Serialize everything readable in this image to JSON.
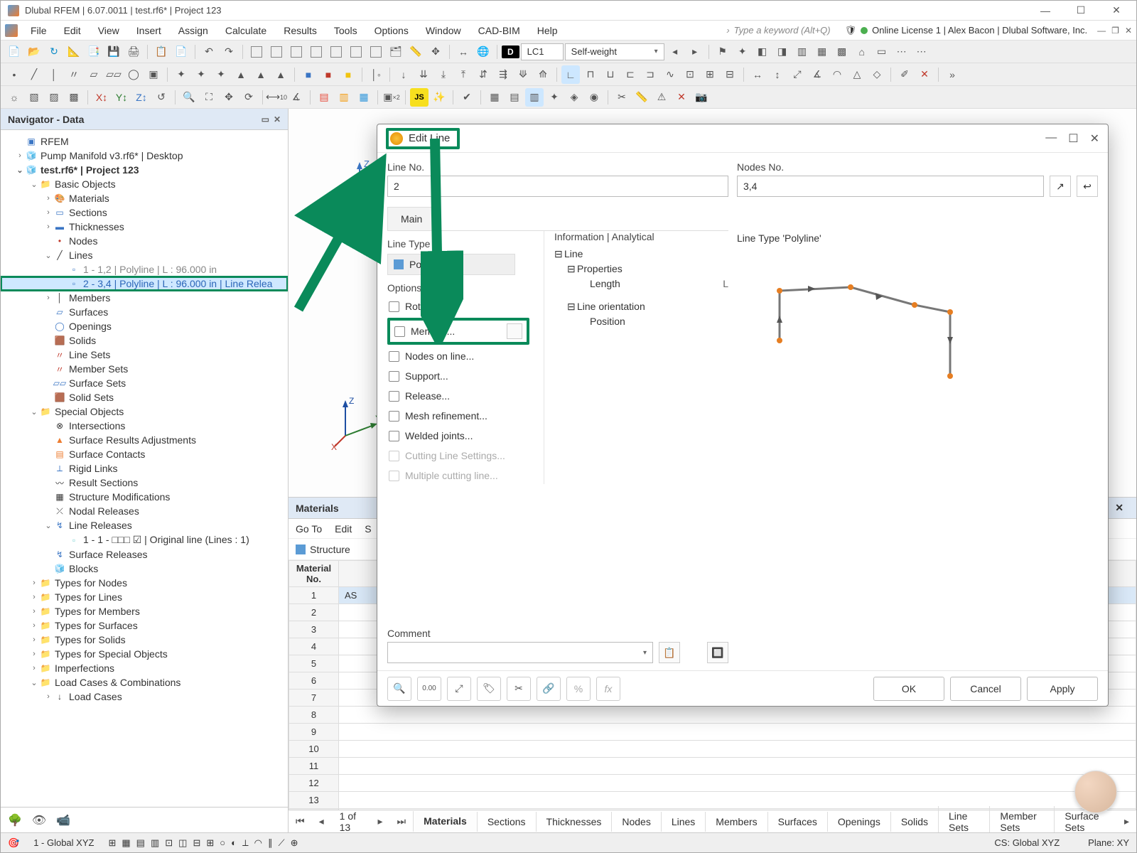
{
  "titlebar": {
    "title": "Dlubal RFEM | 6.07.0011 | test.rf6* | Project 123"
  },
  "menubar": {
    "items": [
      "File",
      "Edit",
      "View",
      "Insert",
      "Assign",
      "Calculate",
      "Results",
      "Tools",
      "Options",
      "Window",
      "CAD-BIM",
      "Help"
    ],
    "search_placeholder": "Type a keyword (Alt+Q)",
    "license": "Online License 1 | Alex Bacon | Dlubal Software, Inc."
  },
  "toolbar2": {
    "lc_badge": "D",
    "lc_code": "LC1",
    "lc_name": "Self-weight"
  },
  "navigator": {
    "title": "Navigator - Data",
    "root": "RFEM",
    "project1": "Pump Manifold v3.rf6* | Desktop",
    "project2": "test.rf6* | Project 123",
    "basic_objects": "Basic Objects",
    "materials": "Materials",
    "sections": "Sections",
    "thicknesses": "Thicknesses",
    "nodes": "Nodes",
    "lines": "Lines",
    "line1": "1 - 1,2 | Polyline | L : 96.000 in",
    "line2": "2 - 3,4 | Polyline | L : 96.000 in | Line Relea",
    "members": "Members",
    "surfaces": "Surfaces",
    "openings": "Openings",
    "solids": "Solids",
    "line_sets": "Line Sets",
    "member_sets": "Member Sets",
    "surface_sets": "Surface Sets",
    "solid_sets": "Solid Sets",
    "special_objects": "Special Objects",
    "intersections": "Intersections",
    "surface_results_adj": "Surface Results Adjustments",
    "surface_contacts": "Surface Contacts",
    "rigid_links": "Rigid Links",
    "result_sections": "Result Sections",
    "structure_mods": "Structure Modifications",
    "nodal_releases": "Nodal Releases",
    "line_releases": "Line Releases",
    "line_release_item": "1 - 1 - □□□ ☑ | Original line (Lines : 1)",
    "surface_releases": "Surface Releases",
    "blocks": "Blocks",
    "types_nodes": "Types for Nodes",
    "types_lines": "Types for Lines",
    "types_members": "Types for Members",
    "types_surfaces": "Types for Surfaces",
    "types_solids": "Types for Solids",
    "types_special": "Types for Special Objects",
    "imperfections": "Imperfections",
    "load_cases": "Load Cases & Combinations",
    "load_cases_sub": "Load Cases"
  },
  "materials_panel": {
    "title": "Materials",
    "menu": [
      "Go To",
      "Edit",
      "S"
    ],
    "sub": "Structure",
    "header": "Material\nNo.",
    "fill_label": "AS"
  },
  "pager": {
    "text": "1 of 13",
    "tabs": [
      "Materials",
      "Sections",
      "Thicknesses",
      "Nodes",
      "Lines",
      "Members",
      "Surfaces",
      "Openings",
      "Solids",
      "Line Sets",
      "Member Sets",
      "Surface Sets"
    ]
  },
  "statusbar": {
    "left": "1 - Global XYZ",
    "cs": "CS: Global XYZ",
    "plane": "Plane: XY"
  },
  "dialog": {
    "title": "Edit Line",
    "line_no_label": "Line No.",
    "line_no": "2",
    "nodes_no_label": "Nodes No.",
    "nodes_no": "3,4",
    "tab_main": "Main",
    "line_type_label": "Line Type",
    "line_type": "Polyline",
    "options_label": "Options",
    "opt_rotation": "Rotation...",
    "opt_member": "Member...",
    "opt_nodes_on_line": "Nodes on line...",
    "opt_support": "Support...",
    "opt_release": "Release...",
    "opt_mesh": "Mesh refinement...",
    "opt_welded": "Welded joints...",
    "opt_cutting": "Cutting Line Settings...",
    "opt_multi_cut": "Multiple cutting line...",
    "info_header": "Information | Analytical",
    "info_line": "Line",
    "info_props": "Properties",
    "info_length": "Length",
    "info_length_val": "L",
    "info_orient": "Line orientation",
    "info_position": "Position",
    "preview_title": "Line Type 'Polyline'",
    "comment_label": "Comment",
    "btn_ok": "OK",
    "btn_cancel": "Cancel",
    "btn_apply": "Apply"
  }
}
